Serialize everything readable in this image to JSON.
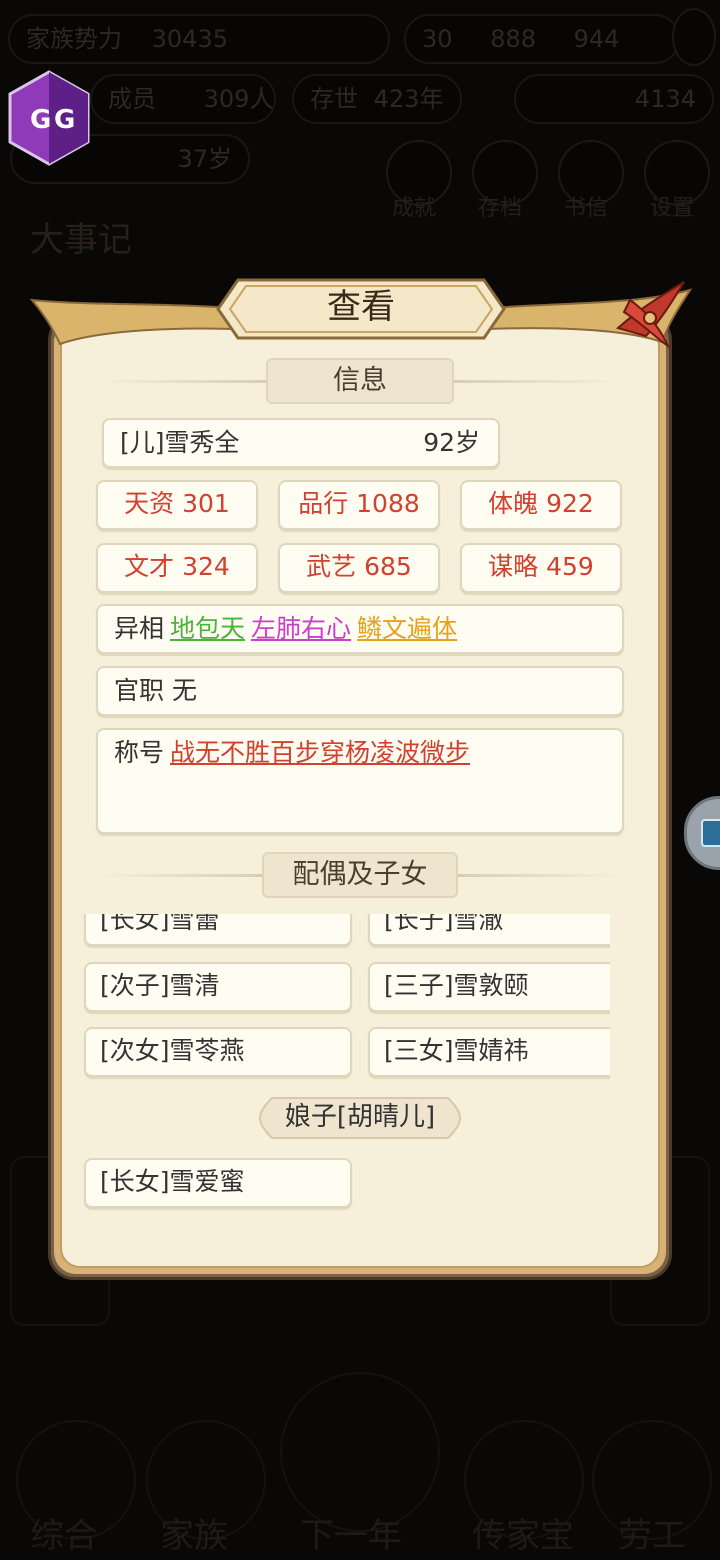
{
  "background": {
    "top_bar": {
      "power_label": "家族势力",
      "power_value": "30435",
      "currency_1": "30",
      "currency_2": "888",
      "currency_3": "944"
    },
    "members_label": "成员",
    "members_value": "309人",
    "lifespan_label": "存世",
    "lifespan_value": "423年",
    "gold_value": "4134",
    "age_value": "37岁",
    "round_buttons": [
      "成就",
      "存档",
      "书信",
      "设置"
    ],
    "events_title": "大事记",
    "bottom_nav": [
      "综合",
      "家族",
      "下一年",
      "传家宝",
      "劳工"
    ]
  },
  "dialog": {
    "title": "查看",
    "info_section": "信息",
    "person": {
      "name": "[儿]雪秀全",
      "age": "92岁"
    },
    "stats": [
      {
        "label": "天资 301"
      },
      {
        "label": "品行 1088"
      },
      {
        "label": "体魄 922"
      },
      {
        "label": "文才 324"
      },
      {
        "label": "武艺 685"
      },
      {
        "label": "谋略 459"
      }
    ],
    "traits_label": "异相",
    "traits": [
      "地包天",
      "左肺右心",
      "鳞文遍体"
    ],
    "office_label": "官职",
    "office_value": "无",
    "honor_label": "称号",
    "honors": "战无不胜百步穿杨凌波微步",
    "family_section": "配偶及子女",
    "children_group_1": [
      "[长女]雪蕾",
      "[长子]雪澈",
      "[次子]雪清",
      "[三子]雪敦颐",
      "[次女]雪苓燕",
      "[三女]雪婧祎"
    ],
    "spouse_2": "娘子[胡晴儿]",
    "children_group_2": [
      "[长女]雪爱蜜"
    ]
  },
  "colors": {
    "stat_red": "#d2402e",
    "trait_green": "#4bb43a",
    "trait_magenta": "#cc3ecc",
    "trait_orange": "#e5a21c",
    "parchment": "#f6f0da"
  },
  "icons": {
    "gg_logo": "gamegardian-logo",
    "close": "close-icon",
    "side": "floating-tool-icon"
  }
}
